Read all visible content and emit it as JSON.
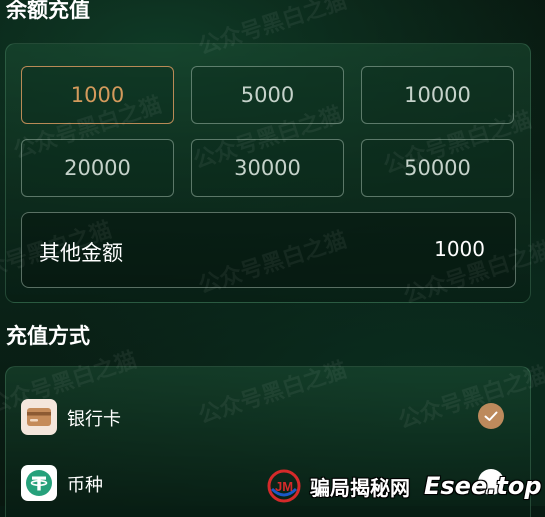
{
  "topup": {
    "title": "余额充值",
    "amounts": [
      {
        "label": "1000",
        "selected": true
      },
      {
        "label": "5000",
        "selected": false
      },
      {
        "label": "10000",
        "selected": false
      },
      {
        "label": "20000",
        "selected": false
      },
      {
        "label": "30000",
        "selected": false
      },
      {
        "label": "50000",
        "selected": false
      }
    ],
    "other_label": "其他金额",
    "other_value": "1000"
  },
  "payment": {
    "title": "充值方式",
    "methods": [
      {
        "label": "银行卡",
        "icon": "bank-card-icon",
        "selected": true
      },
      {
        "label": "币种",
        "icon": "tether-coin-icon",
        "selected": false
      }
    ]
  },
  "watermark": "公众号黑白之猫",
  "overlay": {
    "logo_text": "JM",
    "brand_cn": "骗局揭秘网",
    "brand_en": "Esee.top"
  },
  "colors": {
    "accent": "#bd8a5c",
    "selected_text": "#d39a5c",
    "background": "#071a12"
  }
}
